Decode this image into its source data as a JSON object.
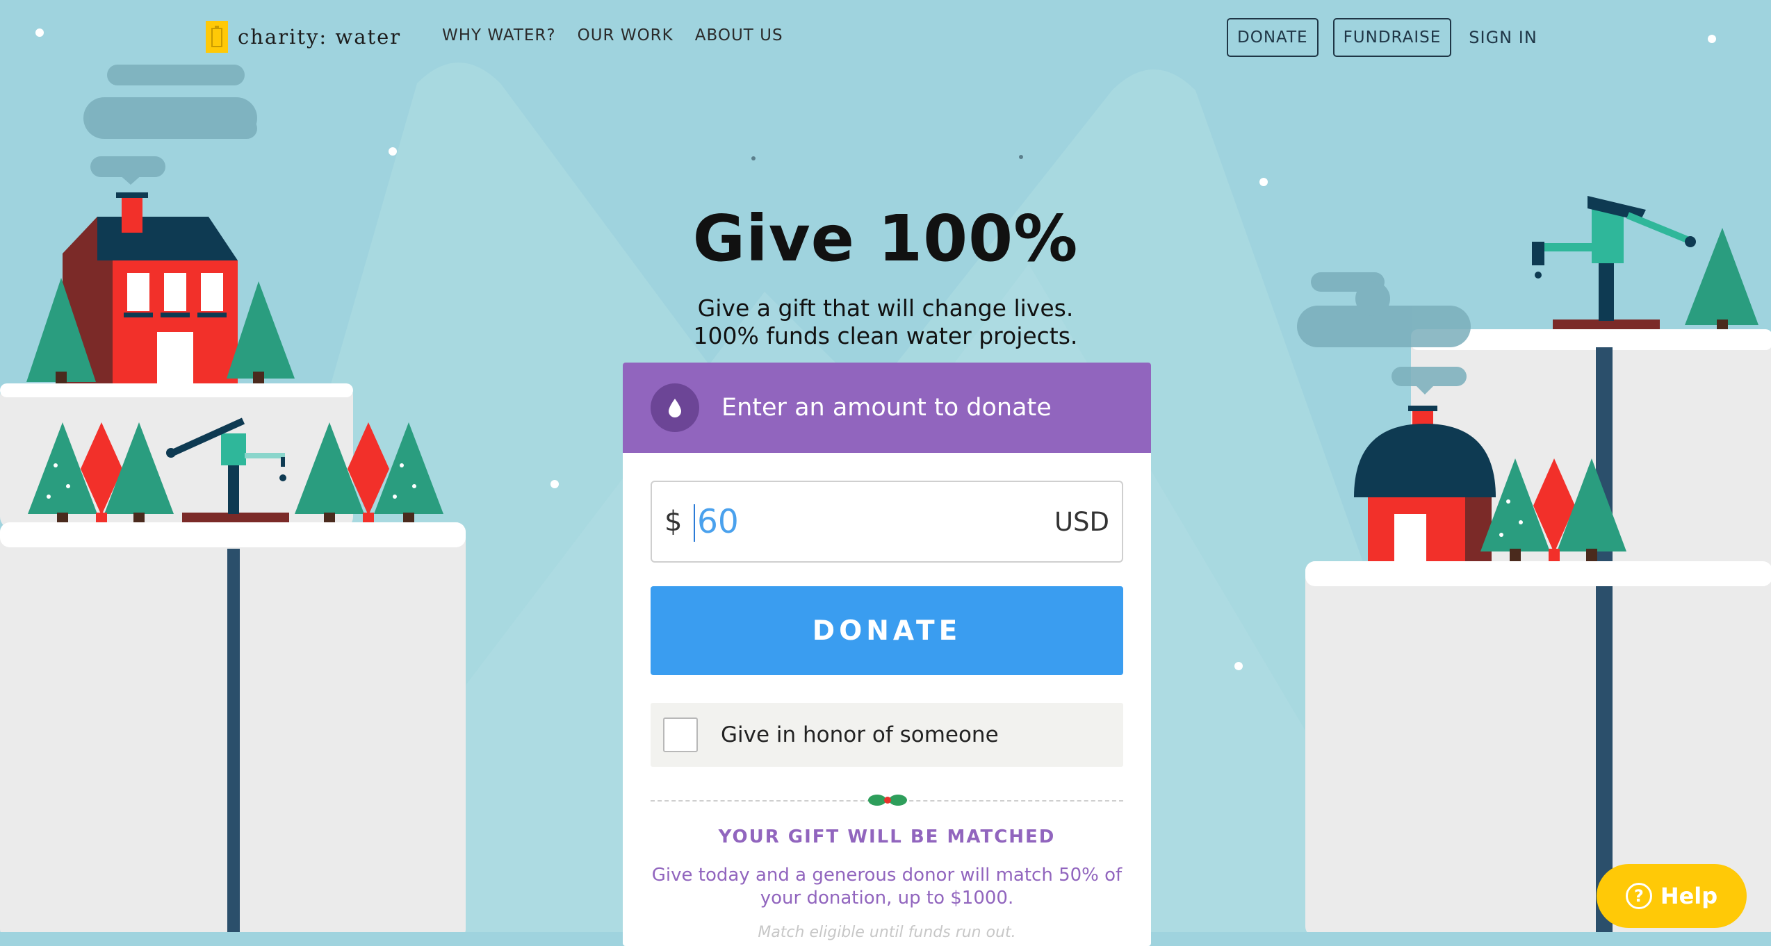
{
  "brand": {
    "name": "charity: water"
  },
  "nav": {
    "links": [
      "WHY WATER?",
      "OUR WORK",
      "ABOUT US"
    ],
    "donate": "DONATE",
    "fundraise": "FUNDRAISE",
    "sign_in": "SIGN IN"
  },
  "hero": {
    "title": "Give 100%",
    "subtitle_line1": "Give a gift that will change lives.",
    "subtitle_line2": "100% funds clean water projects."
  },
  "donation_card": {
    "header_label": "Enter an amount to donate",
    "currency_symbol": "$",
    "amount_value": "60",
    "currency_code": "USD",
    "donate_button": "DONATE",
    "honor_label": "Give in honor of someone",
    "honor_checked": false,
    "matched_title": "YOUR GIFT WILL BE MATCHED",
    "matched_text": "Give today and a generous donor will match 50% of your donation, up to $1000.",
    "matched_more": "Match eligible until funds run out."
  },
  "help": {
    "label": "Help"
  },
  "colors": {
    "background": "#9fd3de",
    "card_header": "#9165be",
    "donate_button": "#3a9df0",
    "help_button": "#ffc907",
    "brand_yellow": "#ffc907"
  }
}
